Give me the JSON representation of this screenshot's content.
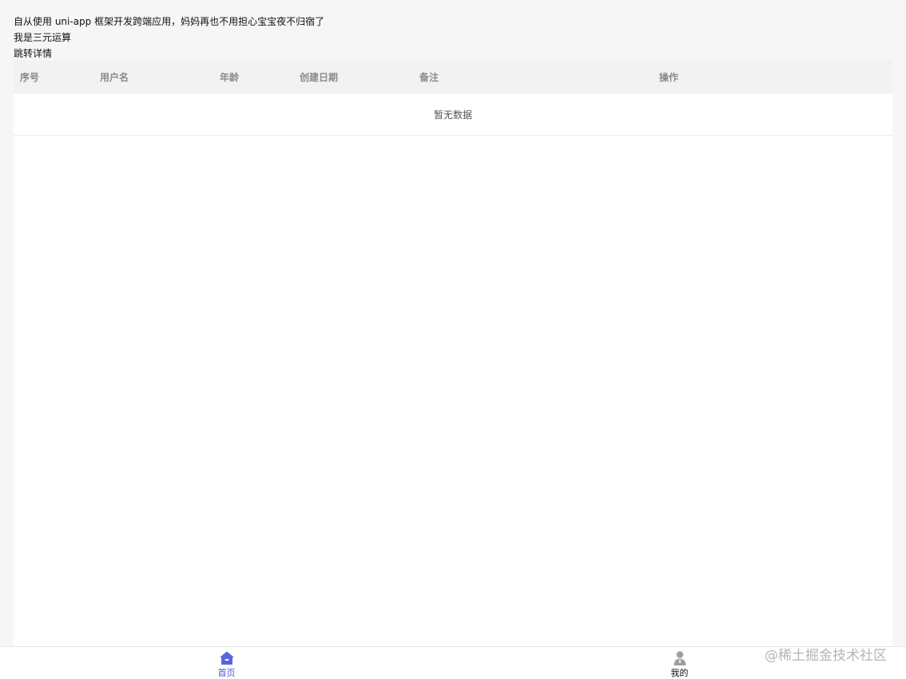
{
  "intro": {
    "line1": "自从使用 uni-app 框架开发跨端应用，妈妈再也不用担心宝宝夜不归宿了",
    "line2": "我是三元运算",
    "link": "跳转详情"
  },
  "table": {
    "headers": [
      "序号",
      "用户名",
      "年龄",
      "创建日期",
      "备注",
      "操作"
    ],
    "empty_text": "暂无数据"
  },
  "tabbar": {
    "items": [
      {
        "label": "首页",
        "icon": "home-icon",
        "active": true
      },
      {
        "label": "我的",
        "icon": "user-icon",
        "active": false
      }
    ]
  },
  "colors": {
    "accent": "#4a56d4",
    "icon_inactive": "#9e9e9e",
    "page_bg": "#f6f6f6"
  },
  "watermark": "@稀土掘金技术社区"
}
